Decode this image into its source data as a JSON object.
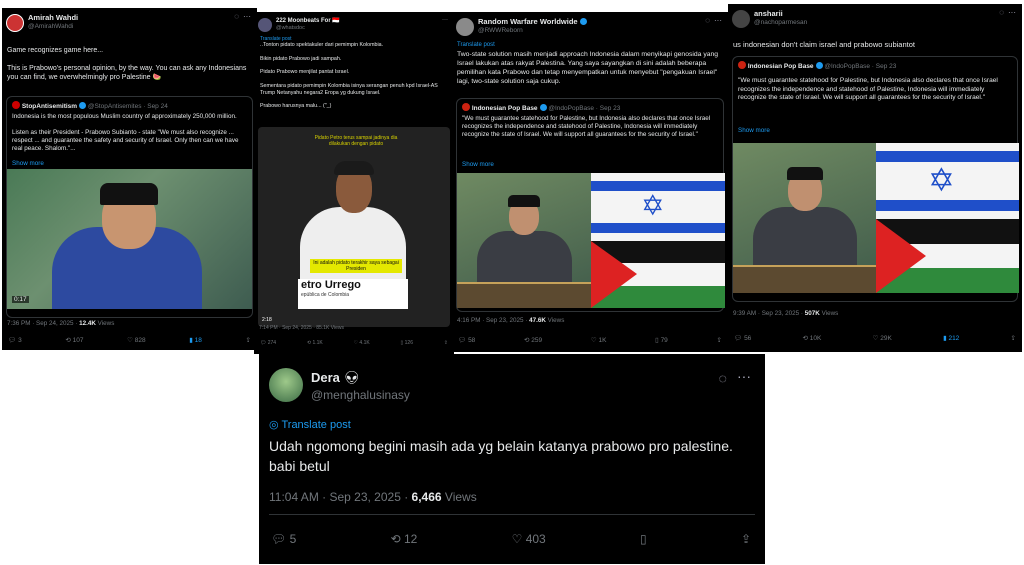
{
  "post1": {
    "name": "Amirah Wahdi",
    "handle": "@AmirahWahdi",
    "text": "Game recognizes game here...\n\nThis is Prabowo's personal opinion, by the way. You can ask any Indonesians you can find, we overwhelmingly pro Palestine 🍉",
    "quote": {
      "name": "StopAntisemitism",
      "handle": "@StopAntisemites · Sep 24",
      "text": "Indonesia is the most populous Muslim country of approximately 250,000 million.\n\nListen as their President - Prabowo Subianto - state \"We must also recognize ... respect ... and guarantee the safety and security of Israel. Only then can we have real peace. Shalom.\"...",
      "show_more": "Show more",
      "video_time": "0:17"
    },
    "meta_time": "7:36 PM · Sep 24, 2025 · ",
    "views": "12.4K",
    "views_label": " Views",
    "replies": "3",
    "reposts": "107",
    "likes": "828",
    "bookmarks": "18"
  },
  "post2": {
    "name": "222 Moonbeats For 🇮🇩",
    "handle": "@whatsdoc",
    "translate": "Translate post",
    "text": "..Tonton pidato spektakuler dari pemimpin Kolombia.\n\nBikin pidato Prabowo jadi sampah.\n\nPidato Prabowo menjilat pantat Israel.\n\nSementara pidato pemimpin Kolombia isinya serangan penuh kpd Israel-AS Trump Netanyahu negara2 Eropa yg dukung Israel.\n\nPrabowo harusnya malu... (\"_)",
    "video_caption_top": "Pidato Petro terus sampai jadinya dia dilakukan dengan pidato",
    "video_caption_mid": "Ini adalah pidato terakhir saya sebagai Presiden",
    "video_name": "etro Urrego",
    "video_sub": "epública de Colombia",
    "video_time": "2:18",
    "meta": "7:14 PM · Sep 24, 2025 · 85.1K Views",
    "replies": "274",
    "reposts": "1.1K",
    "likes": "4.1K",
    "bookmarks": "126"
  },
  "post3": {
    "name": "Random Warfare Worldwide",
    "handle": "@RWWReborn",
    "translate": "Translate post",
    "text": "Two-state solution masih menjadi approach Indonesia dalam menyikapi genosida yang Israel lakukan atas rakyat Palestina. Yang saya sayangkan di sini adalah beberapa pemilihan kata Prabowo dan tetap menyempatkan untuk menyebut \"pengakuan Israel\" lagi, two-state solution saja cukup.",
    "quote": {
      "name": "Indonesian Pop Base",
      "handle": "@IndoPopBase · Sep 23",
      "text": "\"We must guarantee statehood for Palestine, but Indonesia also declares that once Israel recognizes the independence and statehood of Palestine, Indonesia will immediately recognize the state of Israel. We will support all guarantees for the security of Israel.\"",
      "show_more": "Show more"
    },
    "meta_time": "4:16 PM · Sep 23, 2025 · ",
    "views": "47.6K",
    "views_label": " Views",
    "replies": "58",
    "reposts": "259",
    "likes": "1K",
    "bookmarks": "79"
  },
  "post4": {
    "name": "ansharii",
    "handle": "@nachoparmesan",
    "text": "us indonesian don't claim israel and prabowo subiantot",
    "quote": {
      "name": "Indonesian Pop Base",
      "handle": "@IndoPopBase · Sep 23",
      "text": "\"We must guarantee statehood for Palestine, but Indonesia also declares that once Israel recognizes the independence and statehood of Palestine, Indonesia will immediately recognize the state of Israel. We will support all guarantees for the security of Israel.\"",
      "show_more": "Show more"
    },
    "meta_time": "9:39 AM · Sep 23, 2025 · ",
    "views": "507K",
    "views_label": " Views",
    "replies": "56",
    "reposts": "10K",
    "likes": "29K",
    "bookmarks": "212"
  },
  "post5": {
    "name": "Dera",
    "handle": "@menghalusinasy",
    "translate": "Translate post",
    "text": "Udah ngomong begini masih ada yg belain katanya prabowo pro palestine. babi betul",
    "meta_time": "11:04 AM · Sep 23, 2025 · ",
    "views": "6,466",
    "views_label": " Views",
    "replies": "5",
    "reposts": "12",
    "likes": "403"
  },
  "colors": {
    "bg": "#000000",
    "accent": "#1d9bf0",
    "muted": "#71767b",
    "text": "#e7e9ea",
    "bookmark_active": "#1d9bf0"
  }
}
